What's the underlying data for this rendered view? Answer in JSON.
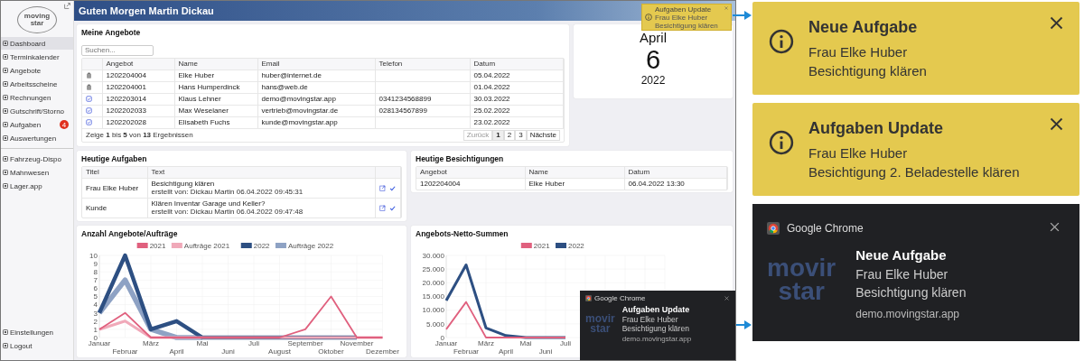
{
  "screenshot": {
    "sidebar": {
      "logo": [
        "moving",
        "star"
      ],
      "items": [
        {
          "label": "Dashboard",
          "selected": true
        },
        {
          "label": "Terminkalender",
          "selected": false
        },
        {
          "label": "Angebote",
          "selected": false
        },
        {
          "label": "Arbeitsscheine",
          "selected": false
        },
        {
          "label": "Rechnungen",
          "selected": false
        },
        {
          "label": "Gutschrift/Storno",
          "selected": false
        },
        {
          "label": "Aufgaben",
          "selected": false,
          "badge": "4"
        },
        {
          "label": "Auswertungen",
          "selected": false
        }
      ],
      "items_2": [
        {
          "label": "Fahrzeug-Dispo",
          "selected": false
        },
        {
          "label": "Mahnwesen",
          "selected": false
        },
        {
          "label": "Lager.app",
          "selected": false
        }
      ],
      "bottom_items": [
        {
          "label": "Einstellungen",
          "selected": false
        },
        {
          "label": "Logout",
          "selected": false
        }
      ]
    },
    "header": {
      "title": "Guten Morgen Martin Dickau"
    },
    "toast": {
      "title": "Aufgaben Update",
      "lines": [
        "Frau Elke Huber",
        "Besichtigung klären"
      ]
    },
    "offers": {
      "title": "Meine Angebote",
      "search": {
        "placeholder": "Suchen..."
      },
      "columns": [
        "Angebot",
        "Name",
        "Email",
        "Telefon",
        "Datum"
      ],
      "rows": [
        {
          "kind": "open",
          "cells": [
            "1202204004",
            "Elke Huber",
            "huber@internet.de",
            "",
            "05.04.2022"
          ]
        },
        {
          "kind": "open",
          "cells": [
            "1202204001",
            "Hans Humperdinck",
            "hans@web.de",
            "",
            "01.04.2022"
          ]
        },
        {
          "kind": "sent",
          "cells": [
            "1202203014",
            "Klaus Lehner",
            "demo@movingstar.app",
            "0341234568899",
            "30.03.2022"
          ]
        },
        {
          "kind": "sent",
          "cells": [
            "1202202033",
            "Max Weselaner",
            "vertrieb@movingstar.de",
            "028134567899",
            "25.02.2022"
          ]
        },
        {
          "kind": "sent",
          "cells": [
            "1202202028",
            "Elisabeth Fuchs",
            "kunde@movingstar.app",
            "",
            "23.02.2022"
          ]
        }
      ],
      "summary": "Zeige **1** bis **5** von **13** Ergebnissen",
      "pager": [
        {
          "label": "Zurück",
          "selected": false,
          "disabled": true
        },
        {
          "label": "1",
          "selected": true,
          "disabled": false
        },
        {
          "label": "2",
          "selected": false,
          "disabled": false
        },
        {
          "label": "3",
          "selected": false,
          "disabled": false
        },
        {
          "label": "Nächste",
          "selected": false,
          "disabled": false
        }
      ]
    },
    "date": {
      "month": "April",
      "day": "6",
      "year": "2022"
    },
    "tasks": {
      "title": "Heutige Aufgaben",
      "columns": [
        "Titel",
        "Text"
      ],
      "rows": [
        {
          "title": "Frau Elke Huber",
          "text": "Besichtigung klären",
          "meta": "erstellt von: Dickau Martin 06.04.2022 09:45:31"
        },
        {
          "title": "Kunde",
          "text": "Klären Inventar Garage und Keller?",
          "meta": "erstellt von: Dickau Martin 06.04.2022 09:47:48"
        }
      ]
    },
    "viewings": {
      "title": "Heutige Besichtigungen",
      "columns": [
        "Angebot",
        "Name",
        "Datum"
      ],
      "rows": [
        [
          "1202204004",
          "Elke Huber",
          "06.04.2022 13:30"
        ]
      ]
    },
    "charts": [
      {
        "title": "Anzahl Angebote/Aufträge",
        "chart_data": {
          "type": "line",
          "grid": true,
          "legend": "top",
          "categories": [
            "Januar",
            "Februar",
            "März",
            "April",
            "Mai",
            "Juni",
            "Juli",
            "August",
            "September",
            "Oktober",
            "November",
            "Dezember"
          ],
          "ylim": [
            0,
            10
          ],
          "yticks": [
            0,
            1,
            2,
            3,
            4,
            5,
            6,
            7,
            8,
            9,
            10
          ],
          "series": [
            {
              "name": "2021",
              "color": "#e0607e",
              "values": [
                1,
                3,
                0,
                0,
                0,
                0,
                0,
                0,
                1,
                5,
                0,
                0
              ]
            },
            {
              "name": "Aufträge 2021",
              "color": "#f0a9b9",
              "values": [
                1,
                2,
                0,
                0,
                0,
                0,
                0,
                0,
                0,
                0,
                0,
                0
              ]
            },
            {
              "name": "2022",
              "color": "#2d4f82",
              "values": [
                3,
                10,
                1,
                2,
                0,
                0,
                0,
                0,
                0,
                0,
                0,
                null
              ]
            },
            {
              "name": "Aufträge 2022",
              "color": "#8ea2c4",
              "values": [
                3,
                7,
                1,
                0,
                0,
                null,
                null,
                null,
                null,
                null,
                null,
                null
              ]
            }
          ]
        }
      },
      {
        "title": "Angebots-Netto-Summen",
        "chart_data": {
          "type": "line",
          "grid": true,
          "legend": "top",
          "categories": [
            "Januar",
            "Februar",
            "März",
            "April",
            "Mai",
            "Juni",
            "Juli"
          ],
          "ylim": [
            0,
            30000
          ],
          "yticks": [
            {
              "value": 0,
              "label": "0"
            },
            {
              "value": 5000,
              "label": "5.000"
            },
            {
              "value": 10000,
              "label": "10.000"
            },
            {
              "value": 15000,
              "label": "15.000"
            },
            {
              "value": 20000,
              "label": "20.000"
            },
            {
              "value": 25000,
              "label": "25.000"
            },
            {
              "value": 30000,
              "label": "30.000"
            }
          ],
          "series": [
            {
              "name": "2021",
              "color": "#e0607e",
              "values": [
                3000,
                13000,
                0,
                0,
                0,
                0,
                0
              ]
            },
            {
              "name": "2022",
              "color": "#2d4f82",
              "values": [
                13500,
                26500,
                3500,
                700,
                0,
                0,
                0
              ]
            }
          ]
        }
      }
    ],
    "chrome_toast": {
      "app": "Google Chrome",
      "logo": [
        "movir",
        "star"
      ],
      "title": "Aufgaben Update",
      "lines": [
        "Frau Elke Huber",
        "Besichtigung klären"
      ],
      "site": "demo.movingstar.app"
    }
  },
  "callouts": [
    {
      "kind": "info",
      "title": "Neue Aufgabe",
      "lines": [
        "Frau Elke Huber",
        "Besichtigung klären"
      ]
    },
    {
      "kind": "info",
      "title": "Aufgaben Update",
      "lines": [
        "Frau Elke Huber",
        "Besichtigung 2. Beladestelle klären"
      ]
    },
    {
      "kind": "chrome",
      "app": "Google Chrome",
      "logo": [
        "movir",
        "star"
      ],
      "title": "Neue Aufgabe",
      "lines": [
        "Frau Elke Huber",
        "Besichtigung klären"
      ],
      "site": "demo.movingstar.app"
    }
  ]
}
